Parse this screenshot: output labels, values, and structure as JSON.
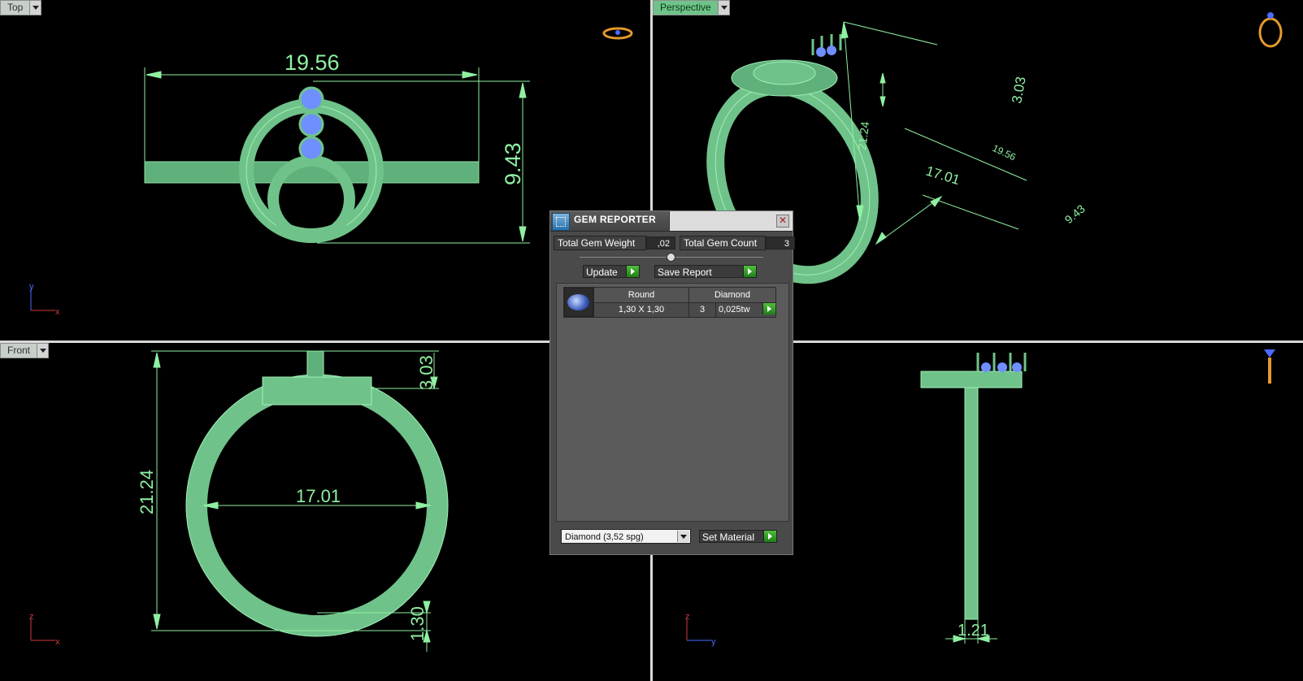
{
  "viewports": {
    "top": {
      "label": "Top"
    },
    "perspective": {
      "label": "Perspective"
    },
    "front": {
      "label": "Front"
    }
  },
  "dimensions": {
    "top_width": "19.56",
    "top_height": "9.43",
    "persp_height": "21.24",
    "persp_head": "3.03",
    "persp_inner": "17.01",
    "persp_outer": "19.56",
    "persp_width": "9.43",
    "front_height": "21.24",
    "front_inner": "17.01",
    "front_head": "3.03",
    "front_shank": "1.30",
    "right_thickness": "1.21"
  },
  "axes": {
    "top": {
      "a": "y",
      "b": "x"
    },
    "front": {
      "a": "z",
      "b": "x"
    },
    "right": {
      "a": "z",
      "b": "y"
    }
  },
  "gem_reporter": {
    "title": "GEM REPORTER",
    "total_weight_label": "Total Gem Weight",
    "total_weight_value": ",02",
    "total_count_label": "Total Gem Count",
    "total_count_value": "3",
    "update_label": "Update",
    "save_label": "Save Report",
    "table": {
      "header_shape": "Round",
      "header_material": "Diamond",
      "size": "1,30 X 1,30",
      "count": "3",
      "weight": "0,025tw"
    },
    "material_select": "Diamond    (3,52 spg)",
    "set_material_label": "Set Material"
  },
  "colors": {
    "model": "#6fc38a",
    "dim": "#8ff0a2",
    "gem": "#6f8fff",
    "background": "#000000"
  }
}
